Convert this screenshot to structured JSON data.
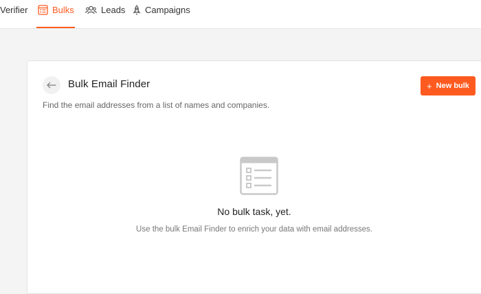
{
  "nav": {
    "items": [
      {
        "label": "Verifier",
        "icon": "verifier-icon",
        "active": false
      },
      {
        "label": "Bulks",
        "icon": "list-icon",
        "active": true
      },
      {
        "label": "Leads",
        "icon": "leads-icon",
        "active": false
      },
      {
        "label": "Campaigns",
        "icon": "rocket-icon",
        "active": false
      }
    ]
  },
  "header": {
    "title": "Bulk Email Finder",
    "subtitle": "Find the email addresses from a list of names and companies.",
    "new_button_label": "New bulk",
    "new_button_icon": "plus-icon"
  },
  "empty_state": {
    "icon": "list-document-icon",
    "title": "No bulk task, yet.",
    "description": "Use the bulk Email Finder to enrich your data with email addresses."
  },
  "colors": {
    "accent": "#ff5a1f",
    "background": "#f4f4f4",
    "card": "#ffffff"
  }
}
